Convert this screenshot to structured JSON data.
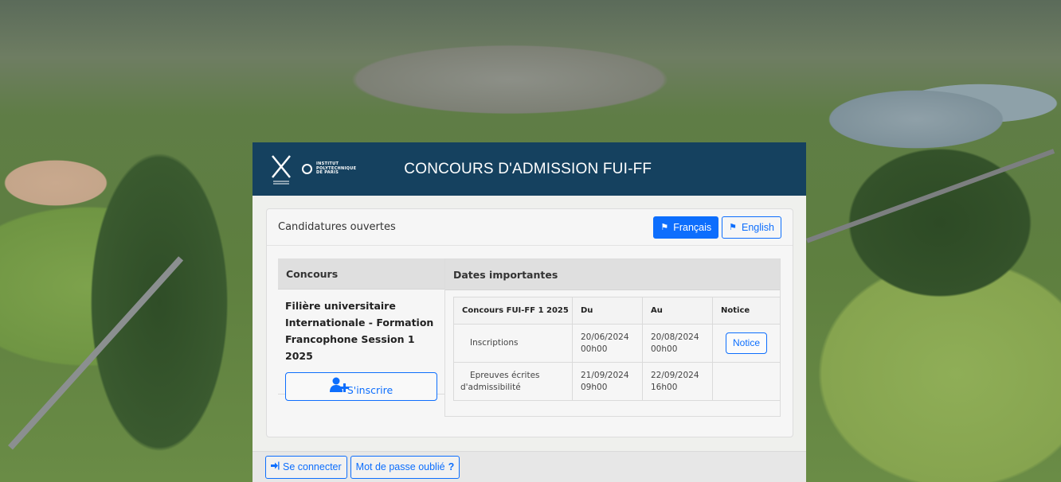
{
  "header": {
    "title": "CONCOURS D'ADMISSION FUI-FF",
    "logo_x_text": "ÉCOLE POLYTECHNIQUE",
    "logo_ipp_lines": [
      "INSTITUT",
      "POLYTECHNIQUE",
      "DE PARIS"
    ]
  },
  "card": {
    "label": "Candidatures ouvertes",
    "lang_fr": "Français",
    "lang_en": "English"
  },
  "concours": {
    "heading": "Concours",
    "name_lines": [
      "Filière universitaire",
      "Internationale - Formation",
      "Francophone Session 1 2025"
    ],
    "register_label": "S'inscrire"
  },
  "dates": {
    "heading": "Dates importantes",
    "columns": [
      "Concours FUI-FF 1 2025",
      "Du",
      "Au",
      "Notice"
    ],
    "rows": [
      {
        "label": "Inscriptions",
        "du": [
          "20/06/2024",
          "00h00"
        ],
        "au": [
          "20/08/2024",
          "00h00"
        ],
        "notice": "Notice"
      },
      {
        "label_lines": [
          "Epreuves écrites",
          "d'admissibilité"
        ],
        "du": [
          "21/09/2024",
          "09h00"
        ],
        "au": [
          "22/09/2024",
          "16h00"
        ],
        "notice": ""
      }
    ]
  },
  "footer": {
    "login": "Se connecter",
    "forgot": "Mot de passe oublié",
    "forgot_q": "?"
  },
  "colors": {
    "header_bg": "#15415f",
    "accent": "#0d6efd"
  }
}
